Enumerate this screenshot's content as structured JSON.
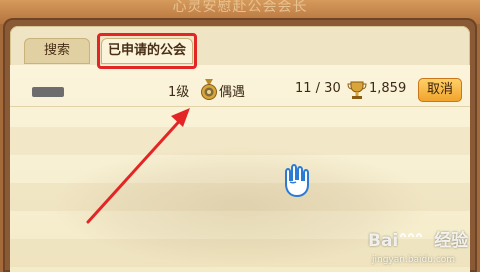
{
  "window": {
    "title": "心灵安慰赴公会会长"
  },
  "tabs": [
    {
      "label": "搜索",
      "selected": false
    },
    {
      "label": "已申请的公会",
      "selected": true
    }
  ],
  "guild_row": {
    "level": "1级",
    "leader": "偶遇",
    "members": "11 / 30",
    "score": "1,859",
    "cancel_label": "取消",
    "medal_icon": "medal-icon",
    "trophy_icon": "trophy-icon"
  },
  "watermark": {
    "brand": "Bai",
    "brand2": "经验",
    "url": "jingyan.baidu.com"
  },
  "colors": {
    "highlight": "#e32525",
    "button": "#f0a22a",
    "panel": "#efe5c4"
  }
}
